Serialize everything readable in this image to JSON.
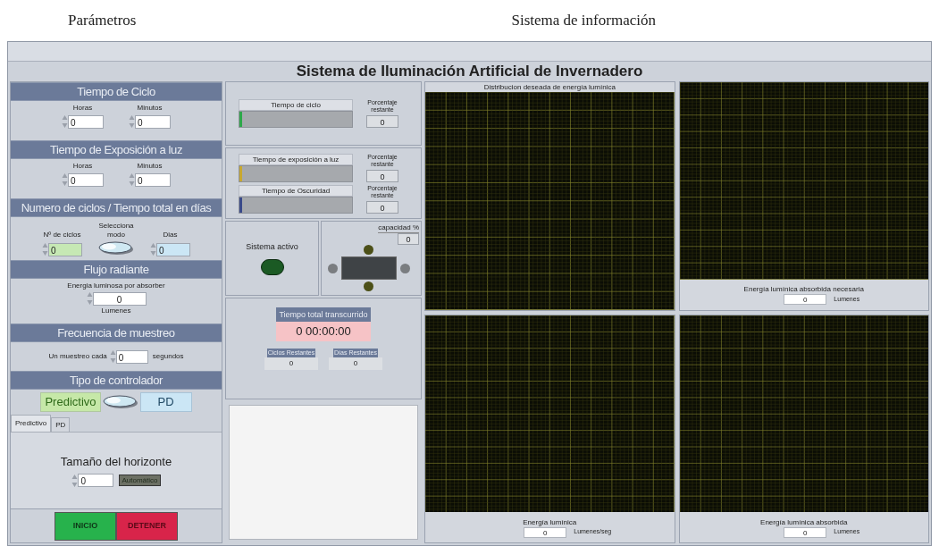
{
  "captions": [
    "Parámetros",
    "Sistema de información"
  ],
  "title": "Sistema de Iluminación Artificial de Invernadero",
  "parameters": {
    "cycle_time": {
      "heading": "Tiempo de Ciclo",
      "fields": [
        {
          "label": "Horas",
          "value": "0"
        },
        {
          "label": "Minutos",
          "value": "0"
        }
      ]
    },
    "exposure_time": {
      "heading": "Tiempo de Exposición a luz",
      "fields": [
        {
          "label": "Horas",
          "value": "0"
        },
        {
          "label": "Minutos",
          "value": "0"
        }
      ]
    },
    "cycles": {
      "heading": "Numero de ciclos / Tiempo total en días",
      "cycles_field": {
        "label": "Nº de ciclos",
        "value": "0"
      },
      "mode_switch": {
        "label": "Selecciona modo",
        "on": false
      },
      "days_field": {
        "label": "Dias",
        "value": "0"
      }
    },
    "radiant_flux": {
      "heading": "Flujo radiante",
      "label": "Energia luminosa por absorber",
      "value": "0",
      "unit": "Lumenes"
    },
    "sampling": {
      "heading": "Frecuencia de muestreo",
      "label": "Un muestreo cada",
      "value": "0",
      "unit": "segundos"
    },
    "controller": {
      "heading": "Tipo de controlador",
      "options": [
        "Predictivo",
        "PD"
      ],
      "switch_on": false,
      "tabs": [
        {
          "label": "Predictivo",
          "selected": true
        },
        {
          "label": "PD",
          "selected": false
        }
      ],
      "horizon": {
        "label": "Tamaño del horizonte",
        "value": "0",
        "auto_button": "Automático",
        "auto_on": false
      }
    },
    "buttons": [
      {
        "label": "INICIO",
        "kind": "start"
      },
      {
        "label": "DETENER",
        "kind": "stop"
      }
    ]
  },
  "info": {
    "progress": [
      {
        "label": "Tiempo de ciclo",
        "level": 0.02,
        "color": "#2ea84a",
        "percent_label": "Porcentaje restante",
        "percent": "0"
      },
      {
        "label": "Tiempo de exposición a luz",
        "level": 0.02,
        "color": "#c8a830",
        "percent_label": "Porcentaje restante",
        "percent": "0"
      },
      {
        "label": "Tiempo de Oscuridad",
        "level": 0.02,
        "color": "#3a4a8a",
        "percent_label": "Porcentaje restante",
        "percent": "0"
      }
    ],
    "status": {
      "label": "Sistema activo",
      "on": false
    },
    "capacity": {
      "label": "capacidad %",
      "value": "0"
    },
    "elapsed": {
      "label": "Tiempo total transcurrido",
      "value": "0  00:00:00"
    },
    "remaining": [
      {
        "label": "Ciclos Restantes",
        "value": "0"
      },
      {
        "label": "Días Restantes",
        "value": "0"
      }
    ]
  },
  "graphs": [
    {
      "title": "Distribucion deseada de energía lumínica"
    },
    {
      "label": "Energía lumínica absorbida necesaria",
      "value": "0",
      "unit": "Lumenes"
    },
    {
      "label": "Energía lumínica",
      "value": "0",
      "unit": "Lumenes/seg"
    },
    {
      "label": "Energía lumínica absorbida",
      "value": "0",
      "unit": "Lumenes"
    }
  ]
}
